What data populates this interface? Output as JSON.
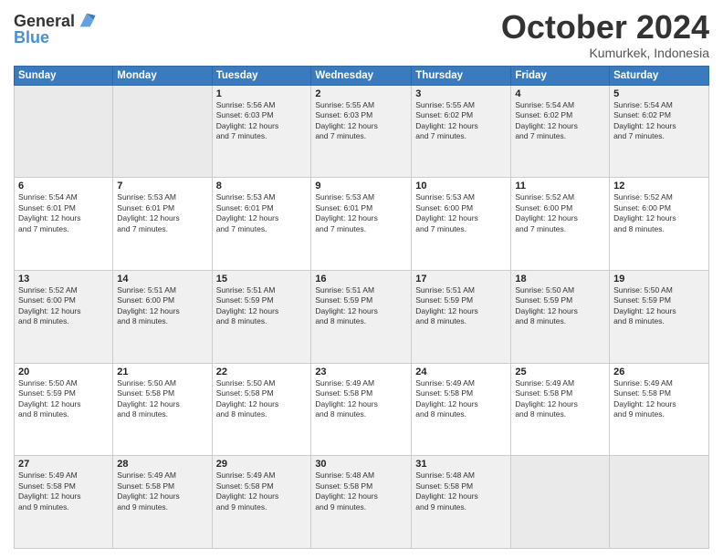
{
  "header": {
    "logo_line1": "General",
    "logo_line2": "Blue",
    "month": "October 2024",
    "location": "Kumurkek, Indonesia"
  },
  "days_of_week": [
    "Sunday",
    "Monday",
    "Tuesday",
    "Wednesday",
    "Thursday",
    "Friday",
    "Saturday"
  ],
  "weeks": [
    [
      {
        "day": "",
        "info": ""
      },
      {
        "day": "",
        "info": ""
      },
      {
        "day": "1",
        "info": "Sunrise: 5:56 AM\nSunset: 6:03 PM\nDaylight: 12 hours\nand 7 minutes."
      },
      {
        "day": "2",
        "info": "Sunrise: 5:55 AM\nSunset: 6:03 PM\nDaylight: 12 hours\nand 7 minutes."
      },
      {
        "day": "3",
        "info": "Sunrise: 5:55 AM\nSunset: 6:02 PM\nDaylight: 12 hours\nand 7 minutes."
      },
      {
        "day": "4",
        "info": "Sunrise: 5:54 AM\nSunset: 6:02 PM\nDaylight: 12 hours\nand 7 minutes."
      },
      {
        "day": "5",
        "info": "Sunrise: 5:54 AM\nSunset: 6:02 PM\nDaylight: 12 hours\nand 7 minutes."
      }
    ],
    [
      {
        "day": "6",
        "info": "Sunrise: 5:54 AM\nSunset: 6:01 PM\nDaylight: 12 hours\nand 7 minutes."
      },
      {
        "day": "7",
        "info": "Sunrise: 5:53 AM\nSunset: 6:01 PM\nDaylight: 12 hours\nand 7 minutes."
      },
      {
        "day": "8",
        "info": "Sunrise: 5:53 AM\nSunset: 6:01 PM\nDaylight: 12 hours\nand 7 minutes."
      },
      {
        "day": "9",
        "info": "Sunrise: 5:53 AM\nSunset: 6:01 PM\nDaylight: 12 hours\nand 7 minutes."
      },
      {
        "day": "10",
        "info": "Sunrise: 5:53 AM\nSunset: 6:00 PM\nDaylight: 12 hours\nand 7 minutes."
      },
      {
        "day": "11",
        "info": "Sunrise: 5:52 AM\nSunset: 6:00 PM\nDaylight: 12 hours\nand 7 minutes."
      },
      {
        "day": "12",
        "info": "Sunrise: 5:52 AM\nSunset: 6:00 PM\nDaylight: 12 hours\nand 8 minutes."
      }
    ],
    [
      {
        "day": "13",
        "info": "Sunrise: 5:52 AM\nSunset: 6:00 PM\nDaylight: 12 hours\nand 8 minutes."
      },
      {
        "day": "14",
        "info": "Sunrise: 5:51 AM\nSunset: 6:00 PM\nDaylight: 12 hours\nand 8 minutes."
      },
      {
        "day": "15",
        "info": "Sunrise: 5:51 AM\nSunset: 5:59 PM\nDaylight: 12 hours\nand 8 minutes."
      },
      {
        "day": "16",
        "info": "Sunrise: 5:51 AM\nSunset: 5:59 PM\nDaylight: 12 hours\nand 8 minutes."
      },
      {
        "day": "17",
        "info": "Sunrise: 5:51 AM\nSunset: 5:59 PM\nDaylight: 12 hours\nand 8 minutes."
      },
      {
        "day": "18",
        "info": "Sunrise: 5:50 AM\nSunset: 5:59 PM\nDaylight: 12 hours\nand 8 minutes."
      },
      {
        "day": "19",
        "info": "Sunrise: 5:50 AM\nSunset: 5:59 PM\nDaylight: 12 hours\nand 8 minutes."
      }
    ],
    [
      {
        "day": "20",
        "info": "Sunrise: 5:50 AM\nSunset: 5:59 PM\nDaylight: 12 hours\nand 8 minutes."
      },
      {
        "day": "21",
        "info": "Sunrise: 5:50 AM\nSunset: 5:58 PM\nDaylight: 12 hours\nand 8 minutes."
      },
      {
        "day": "22",
        "info": "Sunrise: 5:50 AM\nSunset: 5:58 PM\nDaylight: 12 hours\nand 8 minutes."
      },
      {
        "day": "23",
        "info": "Sunrise: 5:49 AM\nSunset: 5:58 PM\nDaylight: 12 hours\nand 8 minutes."
      },
      {
        "day": "24",
        "info": "Sunrise: 5:49 AM\nSunset: 5:58 PM\nDaylight: 12 hours\nand 8 minutes."
      },
      {
        "day": "25",
        "info": "Sunrise: 5:49 AM\nSunset: 5:58 PM\nDaylight: 12 hours\nand 8 minutes."
      },
      {
        "day": "26",
        "info": "Sunrise: 5:49 AM\nSunset: 5:58 PM\nDaylight: 12 hours\nand 9 minutes."
      }
    ],
    [
      {
        "day": "27",
        "info": "Sunrise: 5:49 AM\nSunset: 5:58 PM\nDaylight: 12 hours\nand 9 minutes."
      },
      {
        "day": "28",
        "info": "Sunrise: 5:49 AM\nSunset: 5:58 PM\nDaylight: 12 hours\nand 9 minutes."
      },
      {
        "day": "29",
        "info": "Sunrise: 5:49 AM\nSunset: 5:58 PM\nDaylight: 12 hours\nand 9 minutes."
      },
      {
        "day": "30",
        "info": "Sunrise: 5:48 AM\nSunset: 5:58 PM\nDaylight: 12 hours\nand 9 minutes."
      },
      {
        "day": "31",
        "info": "Sunrise: 5:48 AM\nSunset: 5:58 PM\nDaylight: 12 hours\nand 9 minutes."
      },
      {
        "day": "",
        "info": ""
      },
      {
        "day": "",
        "info": ""
      }
    ]
  ]
}
